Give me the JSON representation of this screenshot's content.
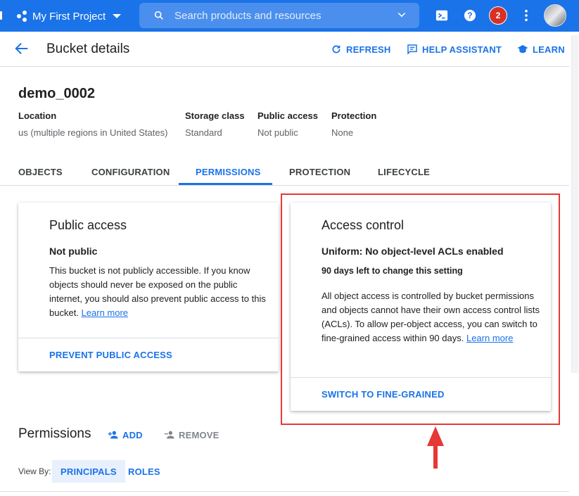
{
  "topbar": {
    "project_name": "My First Project",
    "search_placeholder": "Search products and resources",
    "notification_count": "2",
    "brand_color": "#1a73e8"
  },
  "header": {
    "title": "Bucket details",
    "refresh_label": "REFRESH",
    "help_label": "HELP ASSISTANT",
    "learn_label": "LEARN"
  },
  "bucket": {
    "name": "demo_0002",
    "meta": [
      {
        "label": "Location",
        "value": "us (multiple regions in United States)"
      },
      {
        "label": "Storage class",
        "value": "Standard"
      },
      {
        "label": "Public access",
        "value": "Not public"
      },
      {
        "label": "Protection",
        "value": "None"
      }
    ]
  },
  "tabs": [
    "OBJECTS",
    "CONFIGURATION",
    "PERMISSIONS",
    "PROTECTION",
    "LIFECYCLE"
  ],
  "active_tab": "PERMISSIONS",
  "public_access_card": {
    "title": "Public access",
    "status": "Not public",
    "body": "This bucket is not publicly accessible. If you know objects should never be exposed on the public internet, you should also prevent public access to this bucket.",
    "link": "Learn more",
    "action": "PREVENT PUBLIC ACCESS"
  },
  "access_control_card": {
    "title": "Access control",
    "status": "Uniform: No object-level ACLs enabled",
    "note": "90 days left to change this setting",
    "body": "All object access is controlled by bucket permissions and objects cannot have their own access control lists (ACLs). To allow per-object access, you can switch to fine-grained access within 90 days.",
    "link": "Learn more",
    "action": "SWITCH TO FINE-GRAINED"
  },
  "permissions": {
    "title": "Permissions",
    "add_label": "ADD",
    "remove_label": "REMOVE",
    "view_by_label": "View By:",
    "view_options": [
      "PRINCIPALS",
      "ROLES"
    ],
    "active_view": "PRINCIPALS"
  },
  "annotation_color": "#e53935"
}
